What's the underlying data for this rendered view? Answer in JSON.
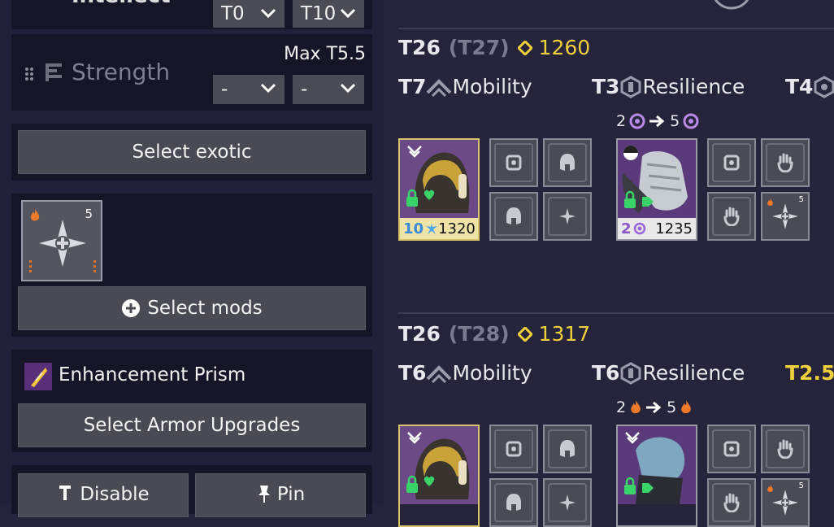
{
  "sidebar": {
    "intellect": {
      "label": "Intellect",
      "min": "T0",
      "max": "T10"
    },
    "strength": {
      "label": "Strength",
      "max_label": "Max T5.5",
      "min": "-",
      "max": "-"
    },
    "select_exotic_label": "Select exotic",
    "mod_tile": {
      "count": "5"
    },
    "select_mods_label": "Select mods",
    "enhancement_prism_label": "Enhancement Prism",
    "select_armor_upgrades_label": "Select Armor Upgrades",
    "bottom_left_button_label": "Disable",
    "pin_label": "Pin"
  },
  "sets": [
    {
      "tier": "T26",
      "tier_max": "(T27)",
      "power": "1260",
      "stats": [
        {
          "tier": "T7",
          "name": "Mobility"
        },
        {
          "tier": "T3",
          "name": "Resilience"
        },
        {
          "tier": "T4",
          "name": ""
        }
      ],
      "upgrade_from": "2",
      "upgrade_to": "5",
      "helmet": {
        "energy": "10",
        "power": "1320"
      },
      "gauntlets": {
        "energy": "2",
        "power": "1235"
      },
      "mod_count": "5"
    },
    {
      "tier": "T26",
      "tier_max": "(T28)",
      "power": "1317",
      "stats": [
        {
          "tier": "T6",
          "name": "Mobility"
        },
        {
          "tier": "T6",
          "name": "Resilience"
        },
        {
          "tier": "T2.5",
          "name": ""
        }
      ],
      "upgrade_from": "2",
      "upgrade_to": "5",
      "mod_count": "5"
    }
  ],
  "colors": {
    "accent_gold": "#f0cf3c",
    "background": "#25243a",
    "panel": "#161528",
    "button": "#4a4a55"
  }
}
